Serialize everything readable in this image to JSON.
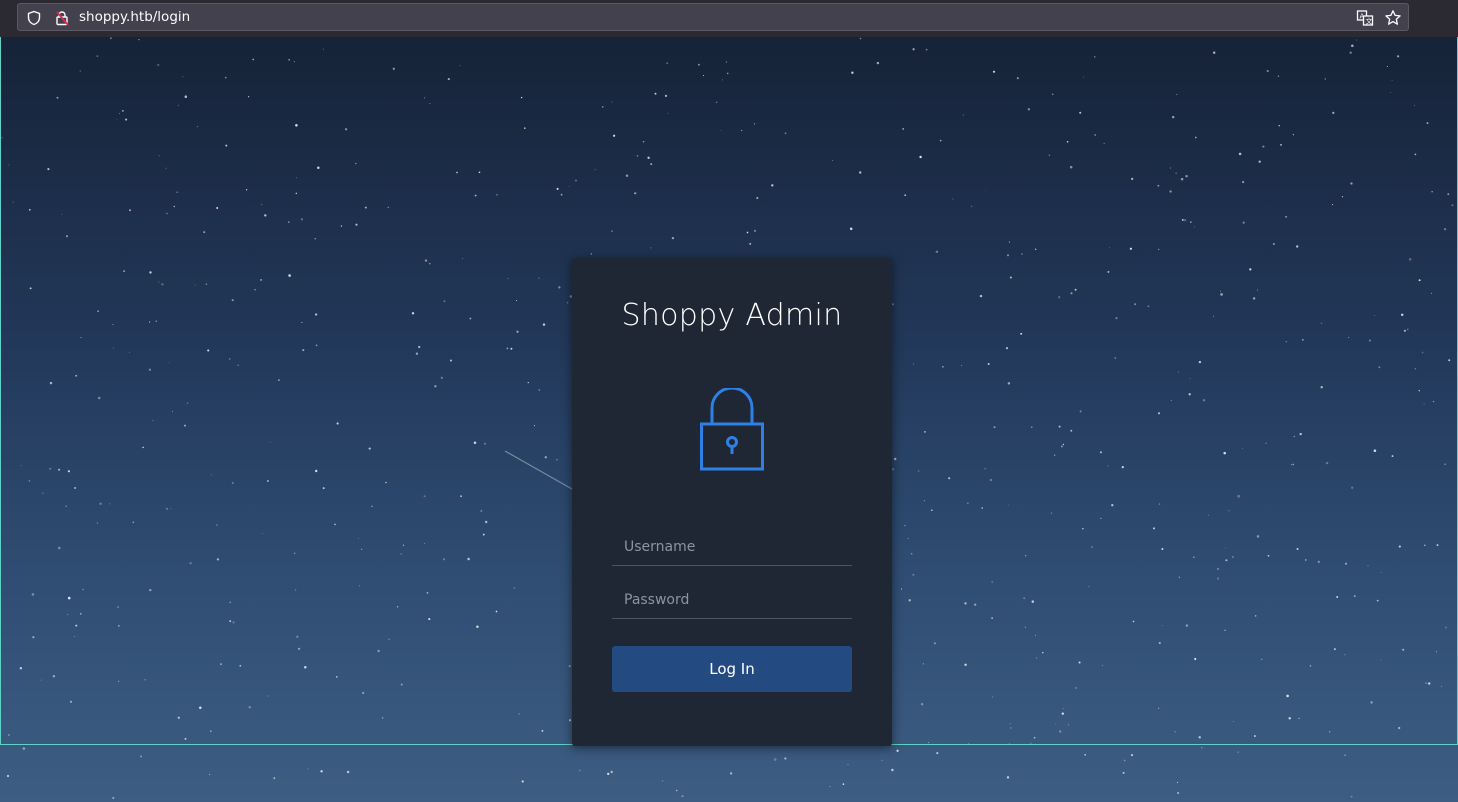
{
  "browser": {
    "url": "shoppy.htb/login",
    "icons": [
      "shield-icon",
      "lock-warning-icon",
      "translate-icon",
      "star-icon"
    ]
  },
  "login": {
    "title": "Shoppy Admin",
    "icon": "padlock-icon",
    "username_placeholder": "Username",
    "password_placeholder": "Password",
    "button_label": "Log In",
    "accent_color": "#2f80e4",
    "button_color": "#234b82",
    "card_color": "#1e2733"
  }
}
